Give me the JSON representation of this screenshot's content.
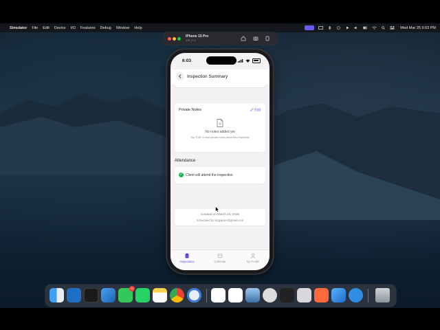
{
  "menubar": {
    "app_name": "Simulator",
    "items": [
      "File",
      "Edit",
      "Device",
      "I/O",
      "Features",
      "Debug",
      "Window",
      "Help"
    ],
    "clock": "Wed Mar 25  6:03 PM"
  },
  "simulator": {
    "device_name": "iPhone 15 Pro",
    "os_version": "iOS 17.2"
  },
  "phone": {
    "status_time": "6:03",
    "nav_title": "Inspection Summary",
    "private_notes": {
      "title": "Private Notes",
      "edit_label": "Edit",
      "empty_title": "No notes added yet",
      "empty_hint": "Tap \"Edit\" to add private notes about this inspection"
    },
    "attendance": {
      "section_title": "Attendance",
      "status_text": "Client will attend the inspection"
    },
    "meta": {
      "created": "Created on March 24, 2026",
      "scheduled_by": "Scheduled by singapore@gmail.com"
    },
    "tabs": [
      {
        "label": "Inspections",
        "icon": "clipboard-icon",
        "active": true
      },
      {
        "label": "Calendar",
        "icon": "calendar-icon",
        "active": false
      },
      {
        "label": "My Profile",
        "icon": "person-icon",
        "active": false
      }
    ]
  },
  "dock": {
    "messages_badge": "32",
    "apps": [
      "finder",
      "vscode",
      "terminal",
      "xcode",
      "messages",
      "whatsapp",
      "notes",
      "chrome",
      "signal",
      "slack",
      "chatgpt",
      "preview",
      "gnome",
      "notion",
      "disk-utility",
      "spark",
      "safari",
      "trash"
    ]
  },
  "colors": {
    "accent": "#5b4fe0",
    "success": "#22b35a"
  }
}
